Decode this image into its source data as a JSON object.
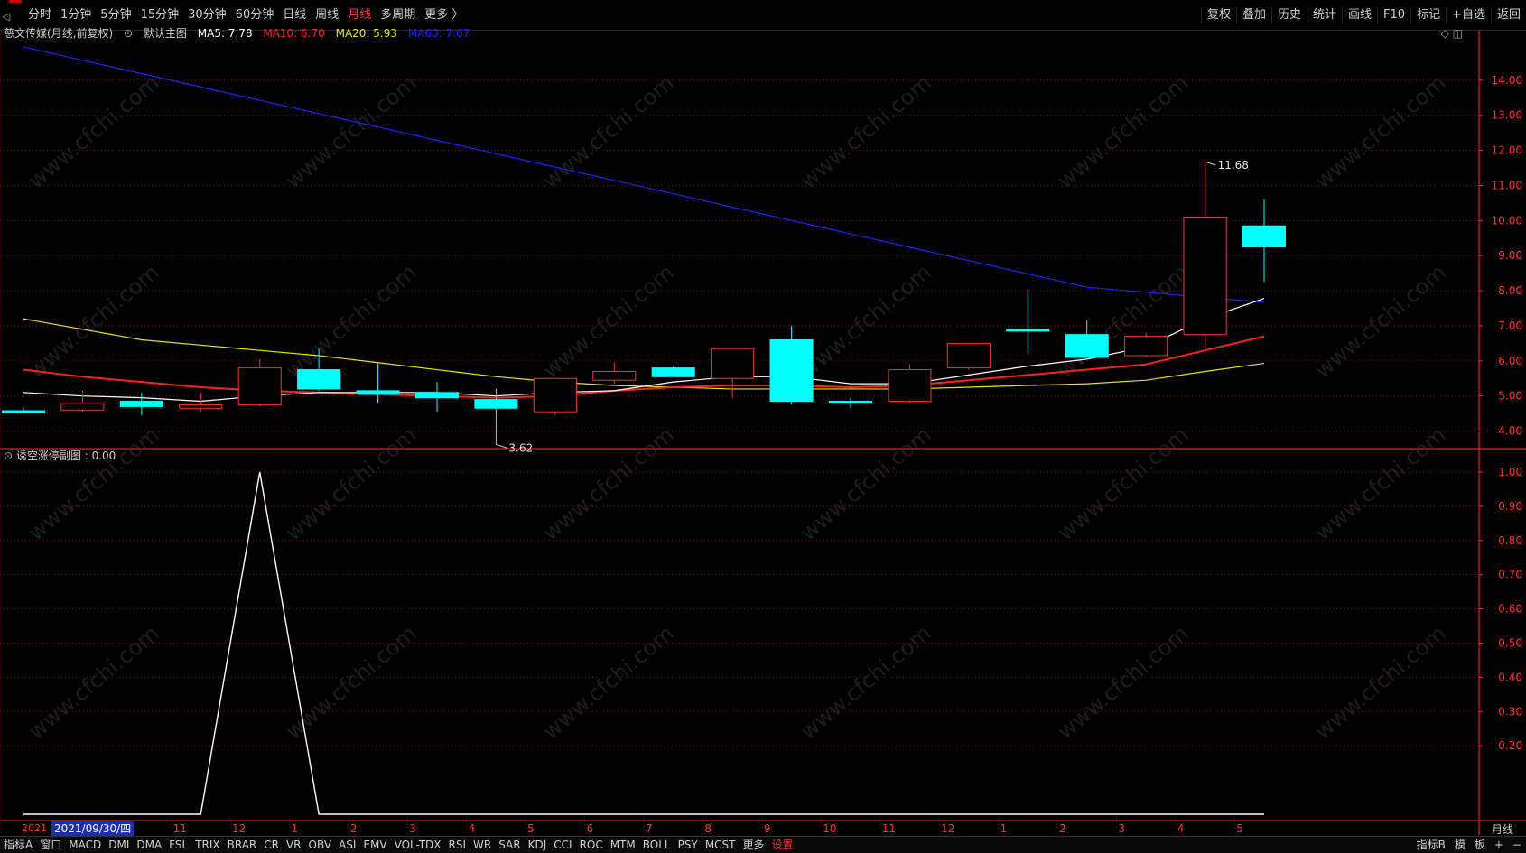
{
  "toolbar": {
    "periods": [
      "分时",
      "1分钟",
      "5分钟",
      "15分钟",
      "30分钟",
      "60分钟",
      "日线",
      "周线",
      "月线",
      "多周期",
      "更多 〉"
    ],
    "active_index": 8,
    "right_tools": [
      "复权",
      "叠加",
      "历史",
      "统计",
      "画线",
      "F10",
      "标记",
      "+自选",
      "返回"
    ]
  },
  "main_info": {
    "stock": "慈文传媒(月线,前复权)",
    "main_chart": "默认主图",
    "ma5_label": "MA5: 7.78",
    "ma10_label": "MA10: 6.70",
    "ma20_label": "MA20: 5.93",
    "ma60_label": "MA60: 7.67"
  },
  "sub_info": {
    "label": "诱空涨停副图 : 0.00"
  },
  "colors": {
    "up": "#ff3030",
    "down": "#00ffff",
    "ma5": "#ffffff",
    "ma10": "#ff2020",
    "ma20": "#e8e800",
    "ma60": "#2020ff",
    "grid": "#8a0000",
    "axis_text": "#ff3030"
  },
  "chart_data": {
    "type": "candlestick",
    "period": "月线",
    "x_ticks": [
      "10",
      "11",
      "12",
      "1",
      "2",
      "3",
      "4",
      "5",
      "6",
      "7",
      "8",
      "9",
      "10",
      "11",
      "12",
      "1",
      "2",
      "3",
      "4",
      "5"
    ],
    "date_prefix": "2021",
    "selected_date": "2021/09/30/四",
    "ylim": [
      3.5,
      15.0
    ],
    "y_ticks": [
      4.0,
      5.0,
      6.0,
      7.0,
      8.0,
      9.0,
      10.0,
      11.0,
      12.0,
      13.0,
      14.0
    ],
    "y_tick_labels": [
      "4.00",
      "5.00",
      "6.00",
      "7.00",
      "8.00",
      "9.00",
      "10.00",
      "11.00",
      "12.00",
      "13.00",
      "14.00"
    ],
    "candles": [
      {
        "o": 4.58,
        "h": 4.68,
        "l": 4.52,
        "c": 4.55
      },
      {
        "o": 4.6,
        "h": 5.15,
        "l": 4.55,
        "c": 4.8
      },
      {
        "o": 4.85,
        "h": 5.1,
        "l": 4.45,
        "c": 4.7
      },
      {
        "o": 4.65,
        "h": 5.1,
        "l": 4.55,
        "c": 4.75
      },
      {
        "o": 4.75,
        "h": 6.05,
        "l": 4.7,
        "c": 5.8
      },
      {
        "o": 5.75,
        "h": 6.35,
        "l": 5.15,
        "c": 5.2
      },
      {
        "o": 5.15,
        "h": 5.95,
        "l": 4.8,
        "c": 5.05
      },
      {
        "o": 5.1,
        "h": 5.4,
        "l": 4.55,
        "c": 4.95
      },
      {
        "o": 4.9,
        "h": 5.2,
        "l": 3.62,
        "c": 4.65
      },
      {
        "o": 4.55,
        "h": 5.5,
        "l": 4.45,
        "c": 5.5
      },
      {
        "o": 5.45,
        "h": 5.95,
        "l": 5.35,
        "c": 5.7
      },
      {
        "o": 5.8,
        "h": 5.85,
        "l": 5.55,
        "c": 5.55
      },
      {
        "o": 5.5,
        "h": 6.35,
        "l": 4.95,
        "c": 6.35
      },
      {
        "o": 6.6,
        "h": 7.0,
        "l": 4.75,
        "c": 4.85
      },
      {
        "o": 4.85,
        "h": 4.95,
        "l": 4.65,
        "c": 4.82
      },
      {
        "o": 4.85,
        "h": 5.9,
        "l": 4.8,
        "c": 5.75
      },
      {
        "o": 5.8,
        "h": 6.5,
        "l": 5.75,
        "c": 6.5
      },
      {
        "o": 6.9,
        "h": 8.05,
        "l": 6.25,
        "c": 6.85
      },
      {
        "o": 6.75,
        "h": 7.15,
        "l": 6.1,
        "c": 6.1
      },
      {
        "o": 6.15,
        "h": 6.8,
        "l": 6.1,
        "c": 6.7
      },
      {
        "o": 6.75,
        "h": 11.68,
        "l": 6.3,
        "c": 10.1
      },
      {
        "o": 9.85,
        "h": 10.6,
        "l": 8.25,
        "c": 9.25
      }
    ],
    "ma5": [
      5.1,
      5.0,
      4.95,
      4.85,
      5.0,
      5.1,
      5.1,
      5.1,
      5.0,
      5.1,
      5.15,
      5.4,
      5.55,
      5.55,
      5.35,
      5.35,
      5.6,
      5.85,
      6.05,
      6.4,
      7.2,
      7.78
    ],
    "ma10": [
      5.75,
      5.55,
      5.4,
      5.25,
      5.15,
      5.1,
      5.05,
      5.0,
      4.95,
      5.0,
      5.15,
      5.25,
      5.3,
      5.3,
      5.25,
      5.3,
      5.45,
      5.6,
      5.75,
      5.9,
      6.3,
      6.7
    ],
    "ma20": [
      7.2,
      6.9,
      6.6,
      6.45,
      6.3,
      6.15,
      5.95,
      5.75,
      5.55,
      5.4,
      5.3,
      5.25,
      5.2,
      5.2,
      5.2,
      5.2,
      5.25,
      5.3,
      5.35,
      5.45,
      5.7,
      5.93
    ],
    "ma60_start": 14.95,
    "ma60_end": 7.67,
    "ma60_knee_index": 18,
    "ma60_knee_value": 8.1,
    "annotations": [
      {
        "candle_index": 20,
        "value": 11.68,
        "text": "11.68"
      },
      {
        "candle_index": 8,
        "value": 3.62,
        "text": "3.62"
      }
    ],
    "sub_chart": {
      "ylim": [
        0.0,
        1.05
      ],
      "y_ticks": [
        0.2,
        0.3,
        0.4,
        0.5,
        0.6,
        0.7,
        0.8,
        0.9,
        1.0
      ],
      "y_tick_labels": [
        "0.20",
        "0.30",
        "0.40",
        "0.50",
        "0.60",
        "0.70",
        "0.80",
        "0.90",
        "1.00"
      ],
      "values": [
        0,
        0,
        0,
        0,
        1,
        0,
        0,
        0,
        0,
        0,
        0,
        0,
        0,
        0,
        0,
        0,
        0,
        0,
        0,
        0,
        0,
        0
      ]
    }
  },
  "watermark": "www.cfchi.com",
  "bottom_bar": {
    "indicators": [
      "指标A",
      "窗口",
      "MACD",
      "DMI",
      "DMA",
      "FSL",
      "TRIX",
      "BRAR",
      "CR",
      "VR",
      "OBV",
      "ASI",
      "EMV",
      "VOL-TDX",
      "RSI",
      "WR",
      "SAR",
      "KDJ",
      "CCI",
      "ROC",
      "MTM",
      "BOLL",
      "PSY",
      "MCST",
      "更多",
      "设置"
    ],
    "highlight_index": 25,
    "right_items": [
      "指标B",
      "模",
      "板",
      "+",
      "−"
    ]
  },
  "period_label": "月线"
}
